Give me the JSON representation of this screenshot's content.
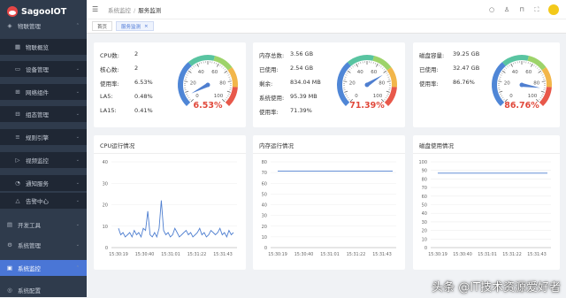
{
  "brand": {
    "name": "SagooIOT"
  },
  "sidebar": {
    "items": [
      {
        "label": "物联管理",
        "icon": "cube-icon",
        "level": "top",
        "chev": "⌃"
      },
      {
        "label": "物联概览",
        "icon": "overview-icon",
        "level": "sub",
        "chev": ""
      },
      {
        "label": "设备管理",
        "icon": "device-icon",
        "level": "sub",
        "chev": "⌄"
      },
      {
        "label": "网络组件",
        "icon": "network-icon",
        "level": "sub",
        "chev": "⌄"
      },
      {
        "label": "组态管理",
        "icon": "topology-icon",
        "level": "sub",
        "chev": "⌄"
      },
      {
        "label": "规则引擎",
        "icon": "rule-icon",
        "level": "sub",
        "chev": "⌄"
      },
      {
        "label": "视频监控",
        "icon": "video-icon",
        "level": "sub",
        "chev": "⌄"
      },
      {
        "label": "通知服务",
        "icon": "bell-icon",
        "level": "sub",
        "chev": "⌄"
      },
      {
        "label": "告警中心",
        "icon": "alert-icon",
        "level": "sub",
        "chev": "⌄"
      },
      {
        "label": "开发工具",
        "icon": "tools-icon",
        "level": "top",
        "chev": "⌄"
      },
      {
        "label": "系统管理",
        "icon": "gear-icon",
        "level": "top",
        "chev": "⌄"
      },
      {
        "label": "系统监控",
        "icon": "monitor-icon",
        "level": "top",
        "chev": "⌃",
        "active": true
      },
      {
        "label": "系统配置",
        "icon": "config-icon",
        "level": "top",
        "chev": ""
      }
    ]
  },
  "header": {
    "crumbs": [
      "系统监控",
      "服务监测"
    ],
    "icons": [
      "search-icon",
      "shirt-icon",
      "lock-icon",
      "fullscreen-icon",
      "avatar"
    ]
  },
  "tabs": [
    {
      "label": "首页",
      "active": false
    },
    {
      "label": "服务监测",
      "active": true,
      "close": "×"
    }
  ],
  "cpu": {
    "rows": [
      [
        "CPU数:",
        "2"
      ],
      [
        "核心数:",
        "2"
      ],
      [
        "使用率:",
        "6.53%"
      ],
      [
        "LA5:",
        "0.48%"
      ],
      [
        "LA15:",
        "0.41%"
      ]
    ],
    "gauge": {
      "value": 6.53,
      "label": "6.53%"
    }
  },
  "memory": {
    "rows": [
      [
        "内存总数:",
        "3.56 GB"
      ],
      [
        "已使用:",
        "2.54 GB"
      ],
      [
        "剩余:",
        "834.04 MB"
      ],
      [
        "系统使用:",
        "95.39 MB"
      ],
      [
        "使用率:",
        "71.39%"
      ]
    ],
    "gauge": {
      "value": 71.39,
      "label": "71.39%"
    }
  },
  "disk": {
    "rows": [
      [
        "磁盘容量:",
        "39.25 GB"
      ],
      [
        "已使用:",
        "32.47 GB"
      ],
      [
        "使用率:",
        "86.76%"
      ]
    ],
    "gauge": {
      "value": 86.76,
      "label": "86.76%"
    }
  },
  "gauge_ticks": [
    "0",
    "20",
    "40",
    "60",
    "80",
    "100"
  ],
  "chart_titles": {
    "cpu": "CPU运行情况",
    "memory": "内存运行情况",
    "disk": "磁盘使用情况"
  },
  "chart_data": [
    {
      "type": "line",
      "title": "CPU运行情况",
      "x": [
        "15:30:19",
        "15:30:40",
        "15:31:01",
        "15:31:22",
        "15:31:43"
      ],
      "ylim": [
        0,
        40
      ],
      "yticks": [
        0,
        10,
        20,
        30,
        40
      ],
      "values": [
        9,
        6,
        7,
        5,
        6,
        7,
        5,
        8,
        6,
        7,
        5,
        9,
        8,
        17,
        6,
        5,
        7,
        5,
        9,
        22,
        8,
        6,
        7,
        5,
        6,
        9,
        7,
        5,
        6,
        7,
        8,
        6,
        7,
        5,
        6,
        7,
        9,
        6,
        7,
        5,
        6,
        8,
        7,
        6,
        7,
        9,
        6,
        7,
        5,
        8,
        6,
        7
      ]
    },
    {
      "type": "line",
      "title": "内存运行情况",
      "x": [
        "15:30:19",
        "15:30:40",
        "15:31:01",
        "15:31:22",
        "15:31:43"
      ],
      "ylim": [
        0,
        80
      ],
      "yticks": [
        0,
        10,
        20,
        30,
        40,
        50,
        60,
        70,
        80
      ],
      "values": [
        71.4,
        71.4,
        71.4,
        71.4,
        71.4,
        71.4,
        71.4,
        71.4,
        71.4,
        71.4,
        71.4,
        71.4,
        71.4,
        71.4,
        71.4,
        71.4,
        71.4,
        71.4,
        71.4,
        71.4
      ]
    },
    {
      "type": "line",
      "title": "磁盘使用情况",
      "x": [
        "15:30:19",
        "15:30:40",
        "15:31:01",
        "15:31:22",
        "15:31:43"
      ],
      "ylim": [
        0,
        100
      ],
      "yticks": [
        0,
        10,
        20,
        30,
        40,
        50,
        60,
        70,
        80,
        90,
        100
      ],
      "values": [
        86.8,
        86.8,
        86.8,
        86.8,
        86.8,
        86.8,
        86.8,
        86.8,
        86.8,
        86.8,
        86.8,
        86.8,
        86.8,
        86.8,
        86.8,
        86.8,
        86.8,
        86.8,
        86.8,
        86.8
      ]
    }
  ],
  "watermark": "头条 @IT技术资源爱好者"
}
